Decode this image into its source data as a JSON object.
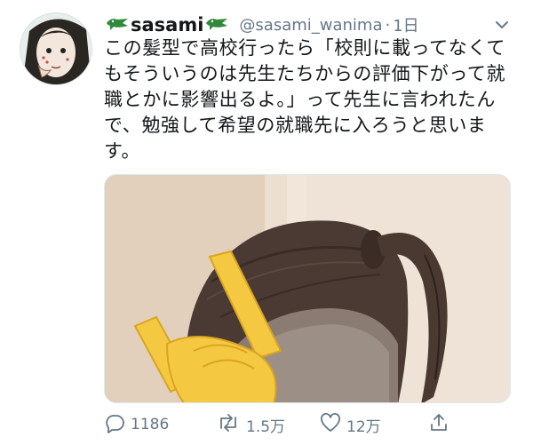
{
  "tweet": {
    "display_name": "sasami",
    "handle": "@sasami_wanima",
    "separator": "·",
    "time": "1日",
    "text_lines": [
      "この髪型で高校行ったら「校則に載ってなくて",
      "もそういうのは先生たちからの評価下がって就",
      "職とかに影響出るよ。」って先生に言われたん",
      "で、勉強して希望の就職先に入ろうと思いま",
      "す。"
    ]
  },
  "actions": {
    "reply_count": "1186",
    "retweet_count": "1.5万",
    "like_count": "12万"
  },
  "icons": {
    "name_emoji": "crocodile-icon",
    "reply": "reply-icon",
    "retweet": "retweet-icon",
    "like": "heart-icon",
    "share": "share-icon",
    "menu": "chevron-down-icon"
  },
  "colors": {
    "text": "#14171a",
    "secondary": "#657786"
  }
}
